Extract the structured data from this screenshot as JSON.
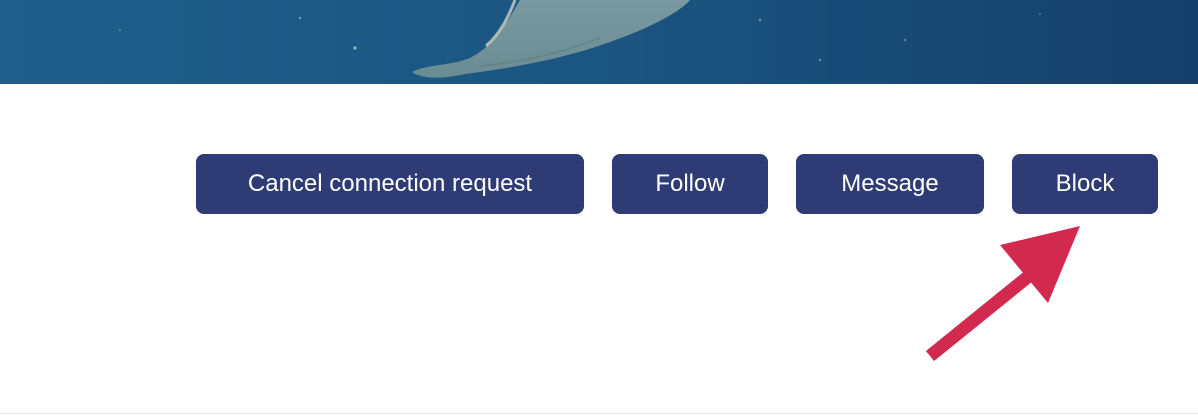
{
  "profile": {
    "cover_photo_icon": "manta-ray-underwater-photo"
  },
  "actions": {
    "cancel_connection_label": "Cancel connection request",
    "follow_label": "Follow",
    "message_label": "Message",
    "block_label": "Block"
  },
  "annotation": {
    "arrow_icon": "arrow-pointing-up-right",
    "arrow_color": "#d22a4e"
  },
  "colors": {
    "button_background": "#2e3b74",
    "button_text": "#ffffff",
    "cover_water": "#1a4f7a"
  }
}
